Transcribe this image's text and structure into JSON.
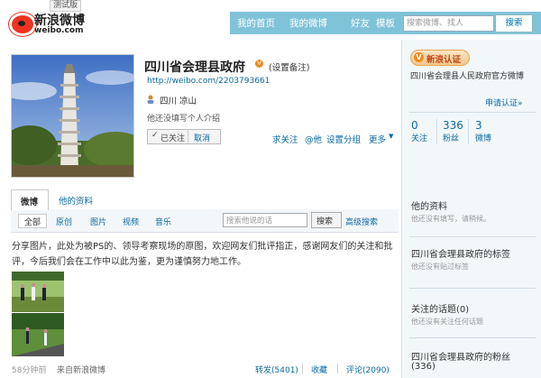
{
  "header": {
    "beta_label": "测试版",
    "logo_cn": "新浪微博",
    "logo_en": "weibo.com",
    "nav": [
      "我的首页",
      "我的微博",
      "好友",
      "模板"
    ],
    "search_placeholder": "搜索微博、找人",
    "search_button": "搜索"
  },
  "profile": {
    "name": "四川省会理县政府",
    "set_remark": "(设置备注)",
    "url": "http://weibo.com/2203793661",
    "location": "四川 凉山",
    "bio": "他还没填写个人介绍",
    "followed_label": "已关注",
    "cancel_label": "取消",
    "actions": [
      "求关注",
      "@他",
      "设置分组",
      "更多"
    ]
  },
  "tabs": {
    "weibo": "微博",
    "info": "他的资料"
  },
  "filters": [
    "全部",
    "原创",
    "图片",
    "视频",
    "音乐"
  ],
  "post_search": {
    "placeholder": "搜索他说的话",
    "button": "搜索",
    "advanced": "高级搜索"
  },
  "post": {
    "text": "分享图片，此处为被PS的、领导考察现场的原图，欢迎网友们批评指正，感谢网友们的关注和批评，今后我们会在工作中以此为鉴，更为谨慎努力地工作。",
    "time": "58分钟前",
    "source": "来自新浪微博",
    "repost": "转发(5401)",
    "favorite": "收藏",
    "comment": "评论(2090)"
  },
  "sidebar": {
    "verified_label": "新浪认证",
    "verified_desc": "四川省会理县人民政府官方微博",
    "apply_verify": "申请认证»",
    "stats": [
      {
        "value": "0",
        "label": "关注"
      },
      {
        "value": "336",
        "label": "粉丝"
      },
      {
        "value": "3",
        "label": "微博"
      }
    ],
    "sections": [
      {
        "title": "他的资料",
        "desc": "他还没有填写，请稍候。"
      },
      {
        "title": "四川省会理县政府的标签",
        "desc": "他还没有贴过标签"
      },
      {
        "title": "关注的话题(0)",
        "desc": "他还没有关注任何话题"
      },
      {
        "title": "四川省会理县政府的粉丝",
        "desc": "(336)"
      }
    ]
  },
  "colors": {
    "nav_bg": "#7fc3d9",
    "link": "#0a6aa1",
    "verified": "#f08b1e",
    "logo_red": "#e32"
  }
}
